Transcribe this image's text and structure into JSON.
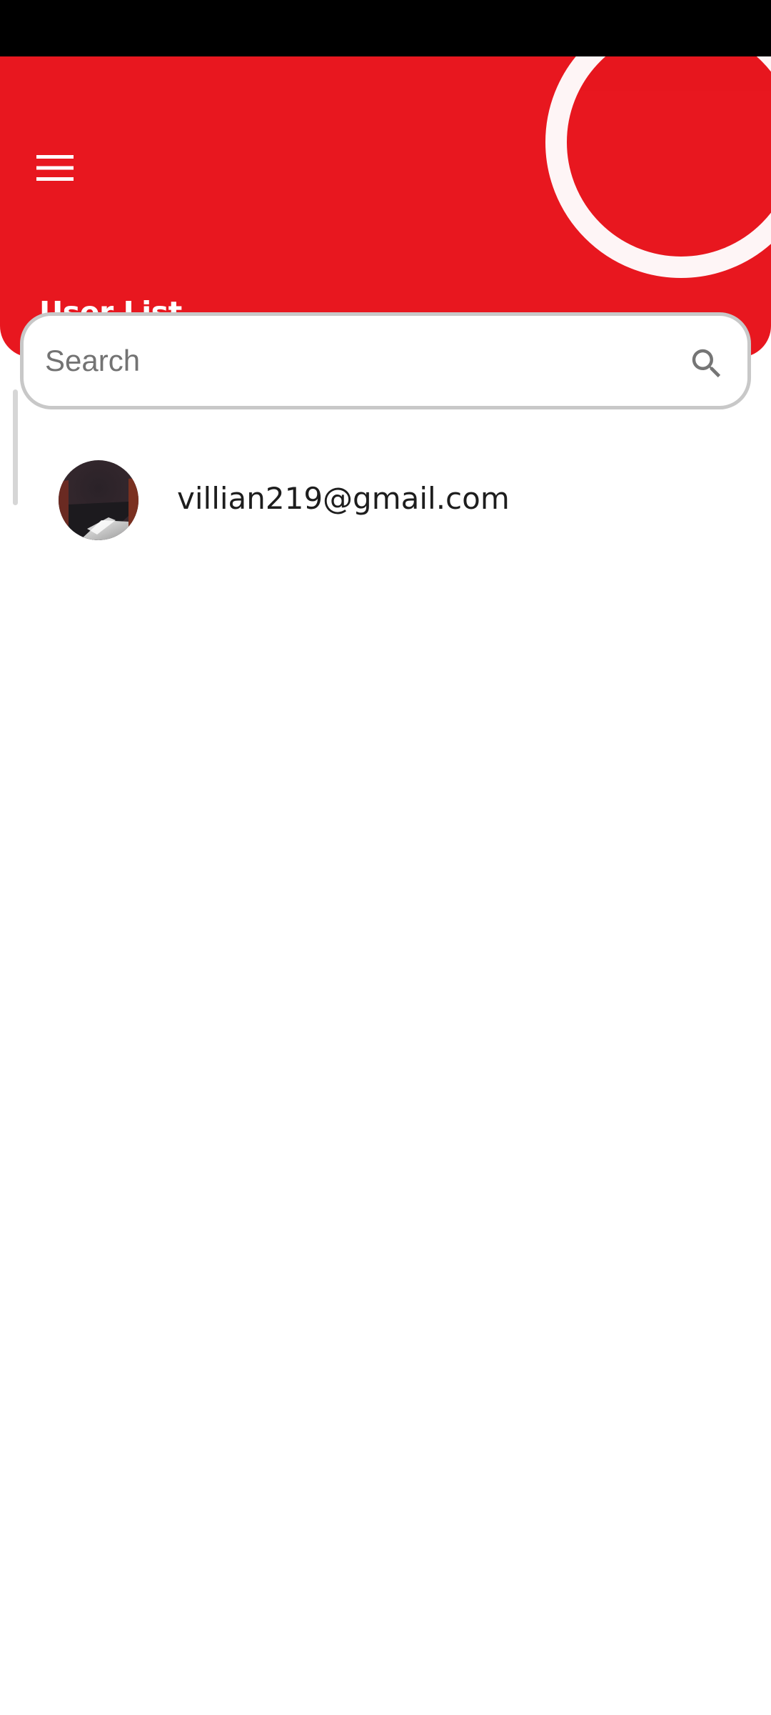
{
  "colors": {
    "header_background": "#E8171F",
    "status_bar": "#000000",
    "page_background": "#FFFFFF",
    "search_border": "#C8C8C8",
    "text_primary": "#1D1D1D",
    "placeholder": "#737373"
  },
  "header": {
    "title": "User List",
    "menu_icon": "hamburger-menu-icon"
  },
  "search": {
    "placeholder": "Search",
    "value": "",
    "icon": "search-icon"
  },
  "users": [
    {
      "email": "villian219@gmail.com",
      "avatar": "profile-photo"
    }
  ]
}
